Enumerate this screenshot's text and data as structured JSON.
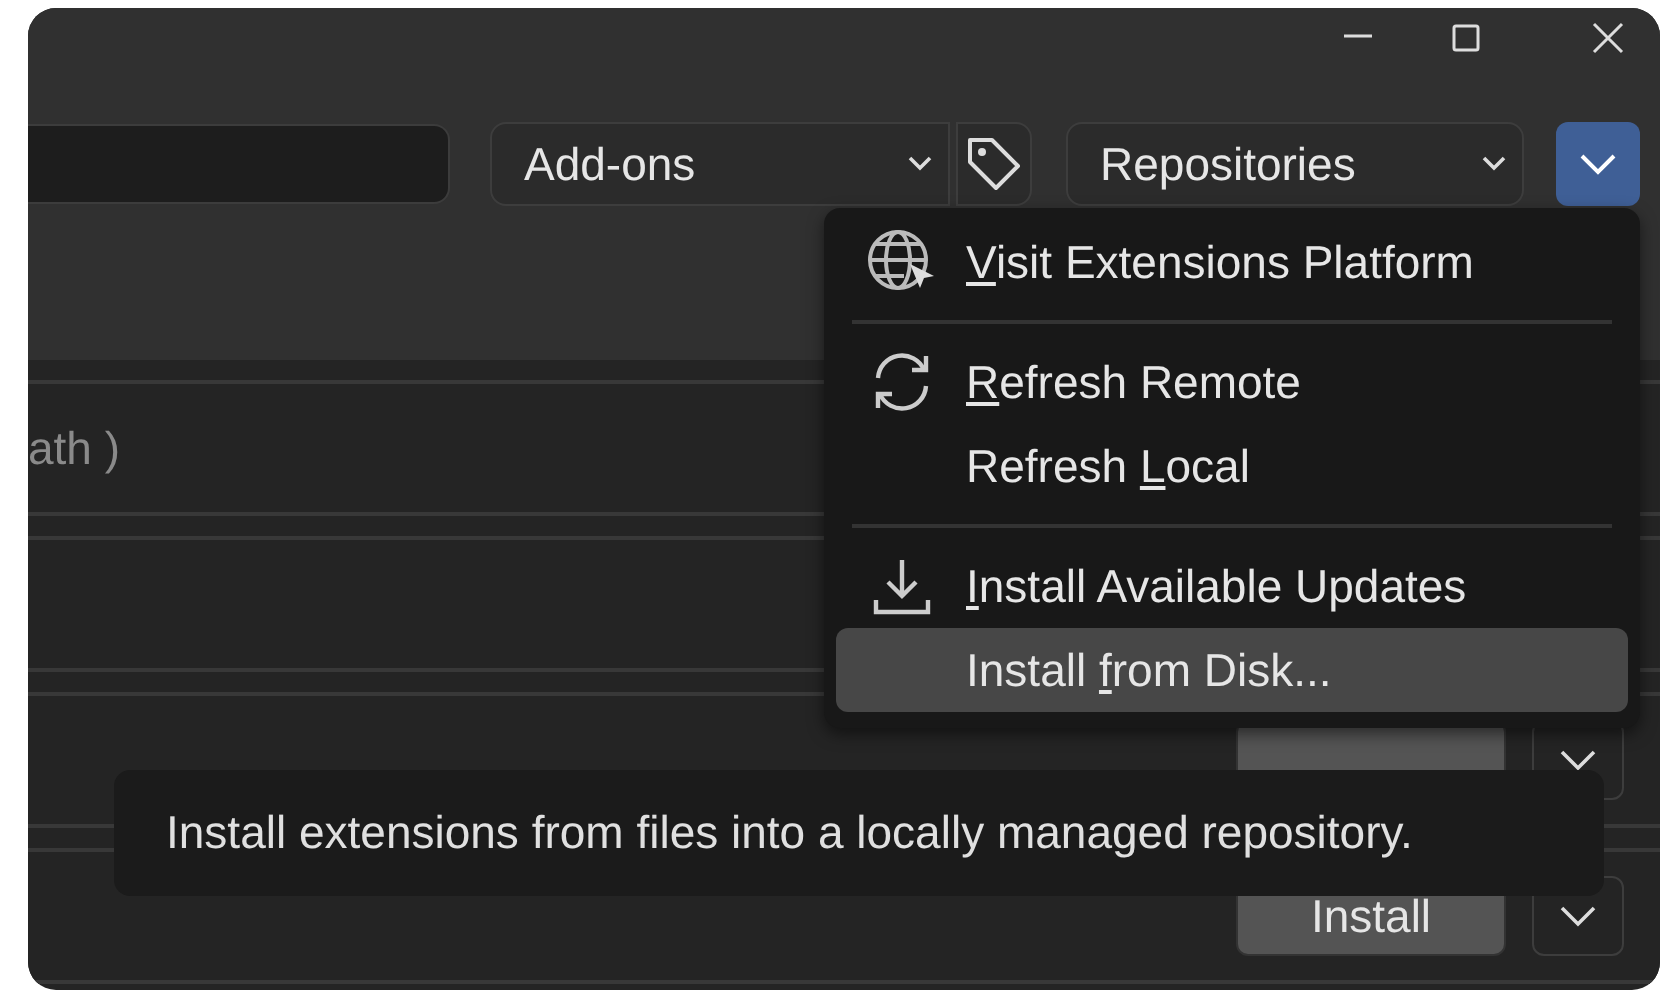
{
  "toolbar": {
    "category": "Add-ons",
    "repository": "Repositories",
    "menu_open": true
  },
  "menu": [
    {
      "kind": "link",
      "mnemonic": "V",
      "suffix": "isit Extensions Platform",
      "selected": false
    },
    {
      "kind": "separator"
    },
    {
      "kind": "refresh",
      "mnemonic": "R",
      "suffix": "efresh Remote",
      "selected": false
    },
    {
      "kind": "action",
      "prefix": "Refresh ",
      "mnemonic": "L",
      "suffix": "ocal",
      "selected": false
    },
    {
      "kind": "separator"
    },
    {
      "kind": "download",
      "mnemonic": "I",
      "suffix": "nstall Available Updates",
      "selected": false
    },
    {
      "kind": "action",
      "prefix": "Install ",
      "mnemonic": "f",
      "suffix": "rom Disk...",
      "selected": true
    }
  ],
  "rows": [
    {
      "kind": "text",
      "text": "ath )"
    },
    {
      "kind": "blank"
    },
    {
      "kind": "install"
    },
    {
      "kind": "install",
      "button": "Install"
    }
  ],
  "tooltip": {
    "text": "Install extensions from files into a locally managed repository."
  }
}
